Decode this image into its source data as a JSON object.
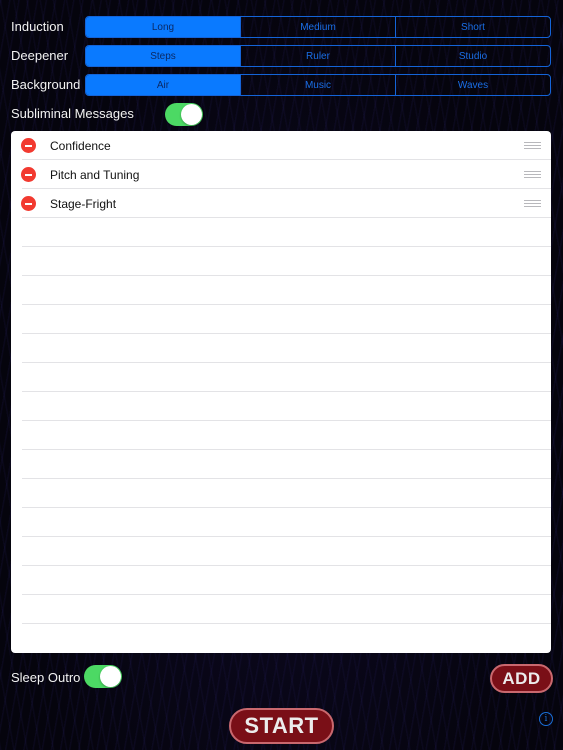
{
  "settings": {
    "induction": {
      "label": "Induction",
      "options": [
        "Long",
        "Medium",
        "Short"
      ],
      "selected": "Long"
    },
    "deepener": {
      "label": "Deepener",
      "options": [
        "Steps",
        "Ruler",
        "Studio"
      ],
      "selected": "Steps"
    },
    "background": {
      "label": "Background",
      "options": [
        "Air",
        "Music",
        "Waves"
      ],
      "selected": "Air"
    },
    "subliminal": {
      "label": "Subliminal Messages",
      "on": true
    }
  },
  "messages": {
    "items": [
      "Confidence",
      "Pitch and Tuning",
      "Stage-Fright"
    ],
    "empty_rows": 15
  },
  "sleep_outro": {
    "label": "Sleep Outro",
    "on": true
  },
  "buttons": {
    "add_label": "ADD",
    "start_label": "START"
  },
  "icons": {
    "delete": "minus-circle-icon",
    "reorder": "reorder-grip-icon",
    "info": "info-icon",
    "info_glyph": "i"
  },
  "colors": {
    "segment_selected": "#0a7aff",
    "toggle_on": "#4cd964",
    "delete_red": "#f23a30",
    "button_red": "#7a0f17"
  }
}
